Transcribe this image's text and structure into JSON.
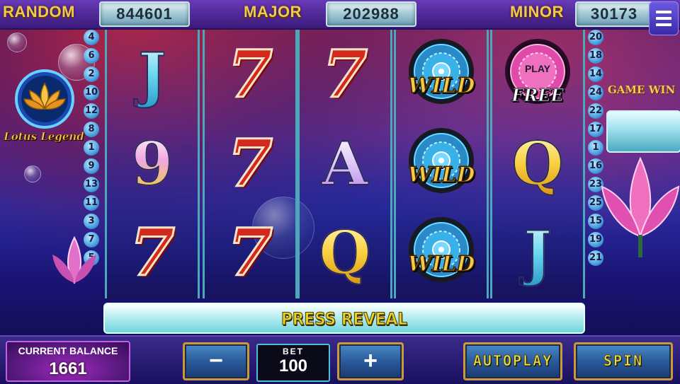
{
  "jackpots": {
    "random": {
      "label": "RANDOM",
      "value": "844601"
    },
    "major": {
      "label": "MAJOR",
      "value": "202988"
    },
    "minor": {
      "label": "MINOR",
      "value": "30173"
    }
  },
  "menu": {
    "icon": "hamburger-menu-icon"
  },
  "logo": {
    "title": "Lotus Legend",
    "icon": "lotus-icon"
  },
  "paylines": {
    "left": [
      "4",
      "6",
      "2",
      "10",
      "12",
      "8",
      "1",
      "9",
      "13",
      "11",
      "3",
      "7",
      "5"
    ],
    "right": [
      "20",
      "18",
      "14",
      "24",
      "22",
      "17",
      "1",
      "16",
      "23",
      "25",
      "15",
      "19",
      "21"
    ]
  },
  "reels": [
    [
      {
        "type": "letter",
        "text": "J"
      },
      {
        "type": "letter",
        "text": "9"
      },
      {
        "type": "seven",
        "text": "7"
      }
    ],
    [
      {
        "type": "seven",
        "text": "7"
      },
      {
        "type": "seven",
        "text": "7"
      },
      {
        "type": "seven",
        "text": "7"
      }
    ],
    [
      {
        "type": "seven",
        "text": "7"
      },
      {
        "type": "letter",
        "text": "A"
      },
      {
        "type": "letter",
        "text": "Q"
      }
    ],
    [
      {
        "type": "wild",
        "text": "WILD"
      },
      {
        "type": "wild",
        "text": "WILD"
      },
      {
        "type": "wild",
        "text": "WILD"
      }
    ],
    [
      {
        "type": "free",
        "top": "PLAY",
        "text": "FREE"
      },
      {
        "type": "letter",
        "text": "Q"
      },
      {
        "type": "letter",
        "text": "J"
      }
    ]
  ],
  "game_win": {
    "label": "GAME WIN",
    "value": ""
  },
  "press_reveal": "PRESS REVEAL",
  "balance": {
    "label": "CURRENT BALANCE",
    "value": "1661"
  },
  "bet": {
    "label": "BET",
    "value": "100"
  },
  "buttons": {
    "minus": "−",
    "plus": "+",
    "autoplay": "AUTOPLAY",
    "spin": "SPIN"
  },
  "colors": {
    "gold": "#f2c94c",
    "reel_border": "#4aa8b8",
    "seven_red": "#d4281e"
  }
}
